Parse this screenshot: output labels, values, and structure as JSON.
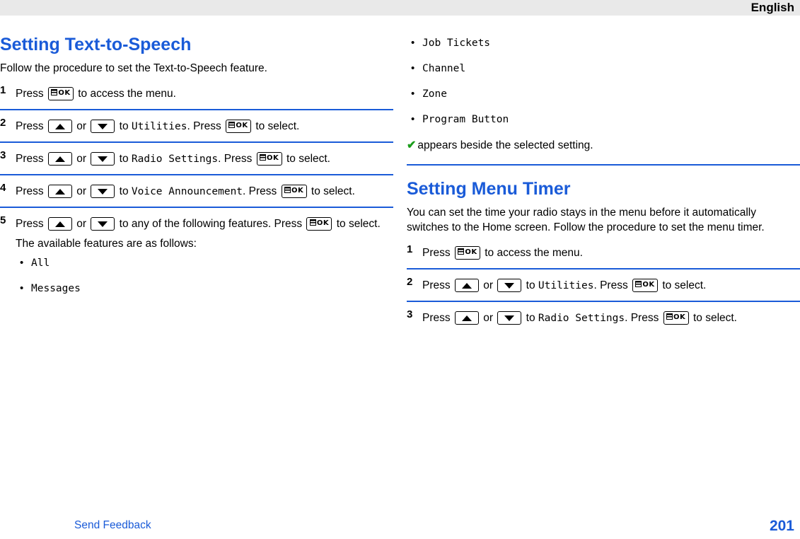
{
  "header": {
    "title": "English"
  },
  "left": {
    "title": "Setting Text-to-Speech",
    "intro": "Follow the procedure to set the Text-to-Speech feature.",
    "steps": [
      {
        "num": "1",
        "parts": [
          {
            "t": "text",
            "v": "Press "
          },
          {
            "t": "key",
            "v": "ok"
          },
          {
            "t": "text",
            "v": " to access the menu."
          }
        ]
      },
      {
        "num": "2",
        "parts": [
          {
            "t": "text",
            "v": "Press "
          },
          {
            "t": "key",
            "v": "up"
          },
          {
            "t": "text",
            "v": " or "
          },
          {
            "t": "key",
            "v": "down"
          },
          {
            "t": "text",
            "v": " to "
          },
          {
            "t": "mono",
            "v": "Utilities"
          },
          {
            "t": "text",
            "v": ". Press "
          },
          {
            "t": "key",
            "v": "ok"
          },
          {
            "t": "text",
            "v": " to select."
          }
        ]
      },
      {
        "num": "3",
        "parts": [
          {
            "t": "text",
            "v": "Press "
          },
          {
            "t": "key",
            "v": "up"
          },
          {
            "t": "text",
            "v": " or "
          },
          {
            "t": "key",
            "v": "down"
          },
          {
            "t": "text",
            "v": " to "
          },
          {
            "t": "mono",
            "v": "Radio Settings"
          },
          {
            "t": "text",
            "v": ". Press "
          },
          {
            "t": "key",
            "v": "ok"
          },
          {
            "t": "text",
            "v": " to select."
          }
        ]
      },
      {
        "num": "4",
        "parts": [
          {
            "t": "text",
            "v": "Press "
          },
          {
            "t": "key",
            "v": "up"
          },
          {
            "t": "text",
            "v": " or "
          },
          {
            "t": "key",
            "v": "down"
          },
          {
            "t": "text",
            "v": " to "
          },
          {
            "t": "mono",
            "v": "Voice Announcement"
          },
          {
            "t": "text",
            "v": ". Press "
          },
          {
            "t": "key",
            "v": "ok"
          },
          {
            "t": "text",
            "v": " to select."
          }
        ]
      },
      {
        "num": "5",
        "parts": [
          {
            "t": "text",
            "v": "Press "
          },
          {
            "t": "key",
            "v": "up"
          },
          {
            "t": "text",
            "v": " or "
          },
          {
            "t": "key",
            "v": "down"
          },
          {
            "t": "text",
            "v": " to any of the following features. Press "
          },
          {
            "t": "key",
            "v": "ok"
          },
          {
            "t": "text",
            "v": " to select."
          },
          {
            "t": "br"
          },
          {
            "t": "text",
            "v": "The available features are as follows:"
          }
        ],
        "bullets": [
          "All",
          "Messages"
        ]
      }
    ]
  },
  "right": {
    "bullets_top": [
      "Job Tickets",
      "Channel",
      "Zone",
      "Program Button"
    ],
    "check_note": "appears beside the selected setting.",
    "title": "Setting Menu Timer",
    "intro": "You can set the time your radio stays in the menu before it automatically switches to the Home screen. Follow the procedure to set the menu timer.",
    "steps": [
      {
        "num": "1",
        "parts": [
          {
            "t": "text",
            "v": "Press "
          },
          {
            "t": "key",
            "v": "ok"
          },
          {
            "t": "text",
            "v": " to access the menu."
          }
        ]
      },
      {
        "num": "2",
        "parts": [
          {
            "t": "text",
            "v": "Press "
          },
          {
            "t": "key",
            "v": "up"
          },
          {
            "t": "text",
            "v": " or "
          },
          {
            "t": "key",
            "v": "down"
          },
          {
            "t": "text",
            "v": " to "
          },
          {
            "t": "mono",
            "v": "Utilities"
          },
          {
            "t": "text",
            "v": ". Press "
          },
          {
            "t": "key",
            "v": "ok"
          },
          {
            "t": "text",
            "v": " to select."
          }
        ]
      },
      {
        "num": "3",
        "parts": [
          {
            "t": "text",
            "v": "Press "
          },
          {
            "t": "key",
            "v": "up"
          },
          {
            "t": "text",
            "v": " or "
          },
          {
            "t": "key",
            "v": "down"
          },
          {
            "t": "text",
            "v": " to "
          },
          {
            "t": "mono",
            "v": "Radio Settings"
          },
          {
            "t": "text",
            "v": ". Press "
          },
          {
            "t": "key",
            "v": "ok"
          },
          {
            "t": "text",
            "v": " to select."
          }
        ]
      }
    ]
  },
  "footer": {
    "link": "Send Feedback",
    "page": "201"
  },
  "colors": {
    "accent": "#1a5bd8",
    "header_bg": "#e9e9e9",
    "check": "#1a9c1a"
  }
}
